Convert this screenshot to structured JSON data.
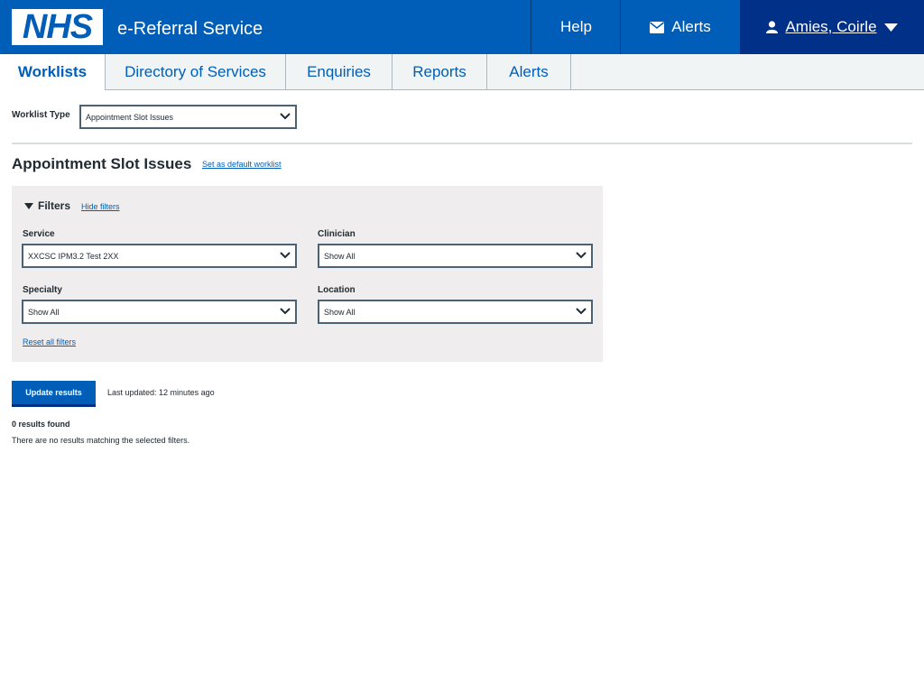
{
  "header": {
    "logo_text": "NHS",
    "service_name": "e-Referral Service",
    "help_label": "Help",
    "alerts_label": "Alerts",
    "user_name": "Amies, Coirle"
  },
  "tabs": [
    {
      "label": "Worklists",
      "active": true
    },
    {
      "label": "Directory of Services",
      "active": false
    },
    {
      "label": "Enquiries",
      "active": false
    },
    {
      "label": "Reports",
      "active": false
    },
    {
      "label": "Alerts",
      "active": false
    }
  ],
  "worklist_type": {
    "label": "Worklist Type",
    "selected": "Appointment Slot Issues"
  },
  "main": {
    "title": "Appointment Slot Issues",
    "set_default_link": "Set as default worklist"
  },
  "filters": {
    "heading": "Filters",
    "hide_link": "Hide filters",
    "service_label": "Service",
    "service_value": "XXCSC IPM3.2 Test 2XX",
    "clinician_label": "Clinician",
    "clinician_value": "Show All",
    "specialty_label": "Specialty",
    "specialty_value": "Show All",
    "location_label": "Location",
    "location_value": "Show All",
    "reset_link": "Reset all filters"
  },
  "results": {
    "update_button": "Update results",
    "last_updated": "Last updated: 12 minutes ago",
    "count_text": "0 results found",
    "empty_message": "There are no results matching the selected filters."
  },
  "colors": {
    "brand_blue": "#005eb8",
    "dark_blue": "#003087",
    "panel_grey": "#efeded"
  },
  "icons": [
    "envelope-icon",
    "user-icon",
    "caret-down-icon",
    "chevron-down-icon"
  ]
}
